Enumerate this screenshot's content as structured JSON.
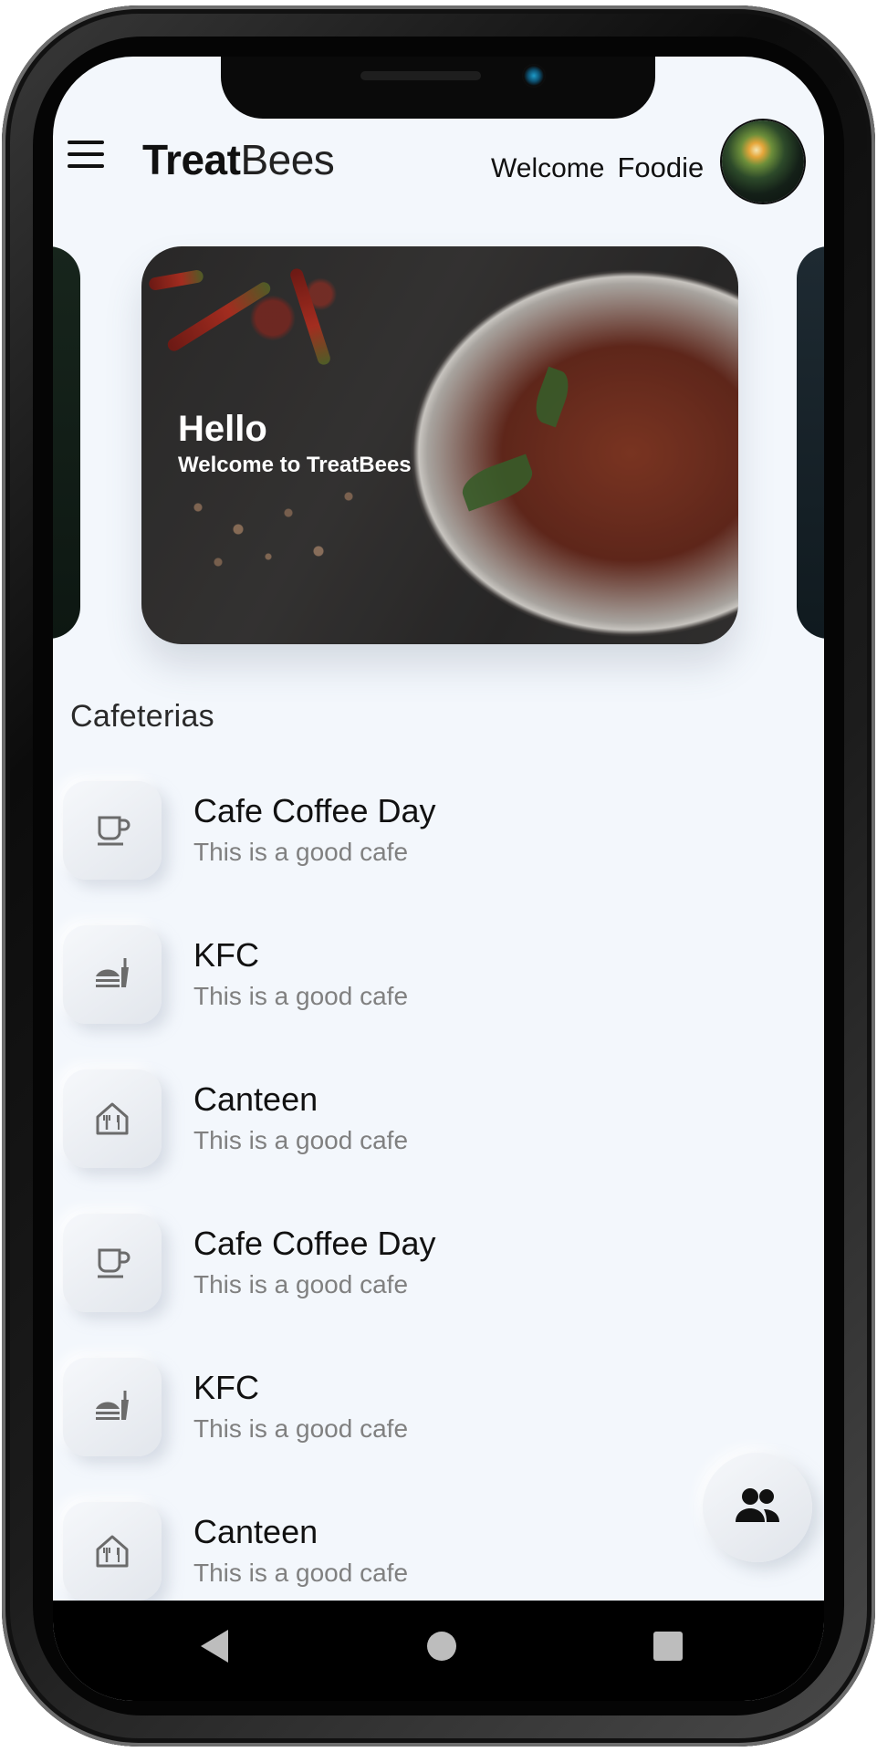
{
  "header": {
    "brand_bold": "Treat",
    "brand_light": "Bees",
    "welcome": "Welcome",
    "user_name": "Foodie"
  },
  "banner": {
    "title": "Hello",
    "subtitle": "Welcome to TreatBees"
  },
  "section": {
    "title": "Cafeterias"
  },
  "cafeterias": [
    {
      "name": "Cafe Coffee Day",
      "description": "This is a good cafe",
      "icon": "coffee-cup-icon"
    },
    {
      "name": "KFC",
      "description": "This is a good cafe",
      "icon": "fast-food-icon"
    },
    {
      "name": "Canteen",
      "description": "This is a good cafe",
      "icon": "restaurant-building-icon"
    },
    {
      "name": "Cafe Coffee Day",
      "description": "This is a good cafe",
      "icon": "coffee-cup-icon"
    },
    {
      "name": "KFC",
      "description": "This is a good cafe",
      "icon": "fast-food-icon"
    },
    {
      "name": "Canteen",
      "description": "This is a good cafe",
      "icon": "restaurant-building-icon"
    }
  ],
  "fab": {
    "icon": "people-icon"
  },
  "navbar": {
    "back_icon": "back-triangle-icon",
    "home_icon": "home-circle-icon",
    "recent_icon": "recent-square-icon"
  },
  "colors": {
    "screen_background": "#f3f7fc",
    "text_primary": "#111111",
    "text_secondary": "#808080",
    "icon_gray": "#6b6b6b"
  }
}
